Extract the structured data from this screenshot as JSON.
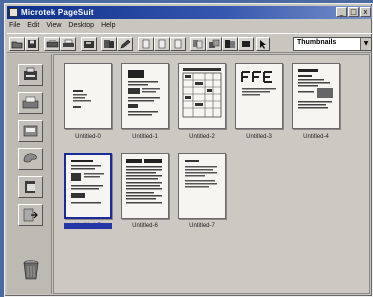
{
  "window": {
    "title": "Microtek PageSuit",
    "controls": [
      "_",
      "□",
      "x"
    ]
  },
  "menu": [
    "File",
    "Edit",
    "View",
    "Desktop",
    "Help"
  ],
  "toolbar": {
    "view_mode": "Thumbnails"
  },
  "pages": [
    {
      "label": "Untitled-0"
    },
    {
      "label": "Untitled-1"
    },
    {
      "label": "Untitled-2"
    },
    {
      "label": "Untitled-3"
    },
    {
      "label": "Untitled-4"
    },
    {
      "label": "Untitled-5",
      "selected": true
    },
    {
      "label": "Untitled-6"
    },
    {
      "label": "Untitled-7"
    }
  ]
}
